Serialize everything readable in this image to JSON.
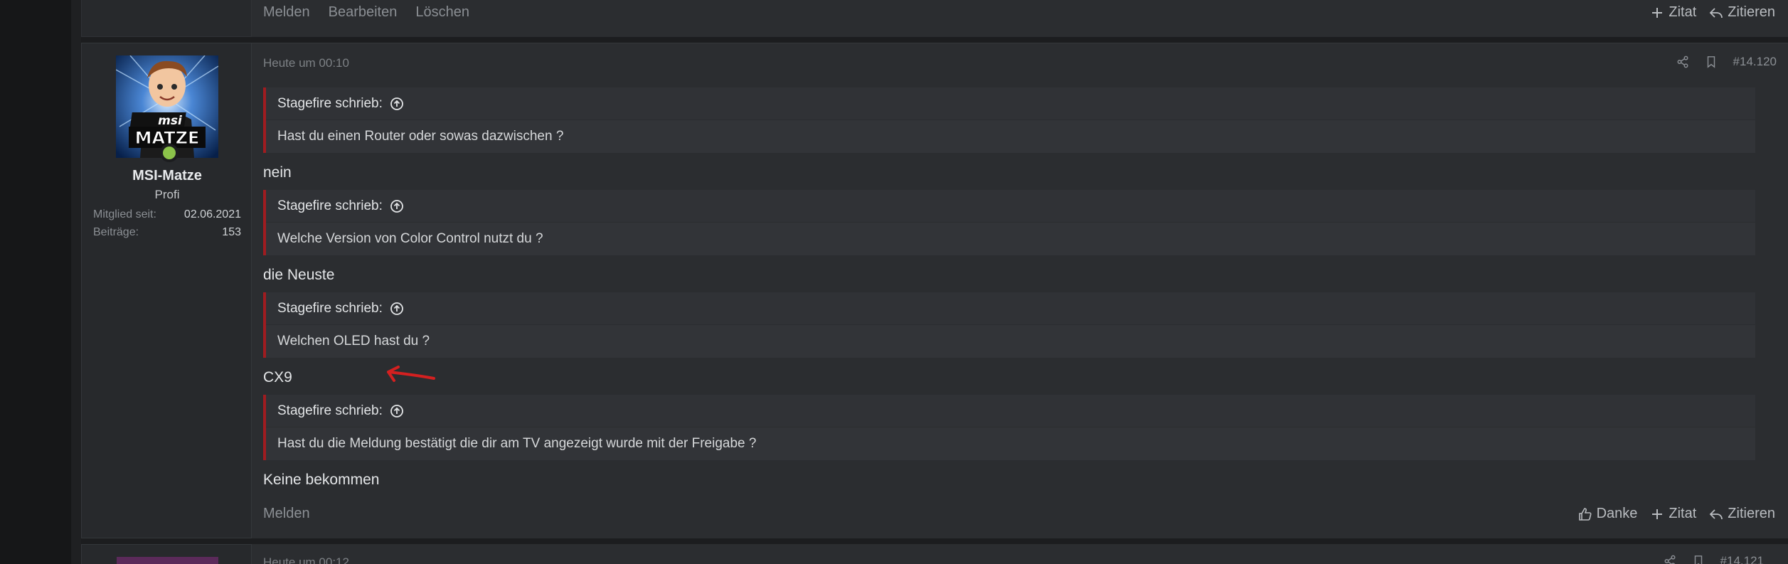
{
  "prev_post": {
    "footer_left": [
      "Melden",
      "Bearbeiten",
      "Löschen"
    ],
    "footer_right": {
      "quote_label": "Zitat",
      "reply_label": "Zitieren"
    }
  },
  "post": {
    "user": {
      "avatar_text_top": "msi",
      "avatar_text_bottom": "MATZE",
      "username": "MSI-Matze",
      "title": "Profi",
      "stats": [
        {
          "key": "Mitglied seit:",
          "value": "02.06.2021"
        },
        {
          "key": "Beiträge:",
          "value": "153"
        }
      ],
      "status_color": "#8bc34a"
    },
    "date": "Heute um 00:10",
    "post_number": "#14.120",
    "quotes": [
      {
        "author": "Stagefire schrieb:",
        "text": "Hast du einen Router oder sowas dazwischen ?",
        "reply": "nein"
      },
      {
        "author": "Stagefire schrieb:",
        "text": "Welche Version von Color Control nutzt du ?",
        "reply": "die Neuste"
      },
      {
        "author": "Stagefire schrieb:",
        "text": "Welchen OLED hast du ?",
        "reply": "CX9"
      },
      {
        "author": "Stagefire schrieb:",
        "text": "Hast du die Meldung bestätigt die dir am TV angezeigt wurde mit der Freigabe ?",
        "reply": "Keine bekommen"
      }
    ],
    "footer_left": "Melden",
    "footer_right": {
      "thanks_label": "Danke",
      "quote_label": "Zitat",
      "reply_label": "Zitieren"
    },
    "quote_border_color": "#a01c20",
    "annotation_color": "#d42020"
  },
  "next_post": {
    "date": "Heute um 00:12",
    "post_number": "#14.121"
  }
}
